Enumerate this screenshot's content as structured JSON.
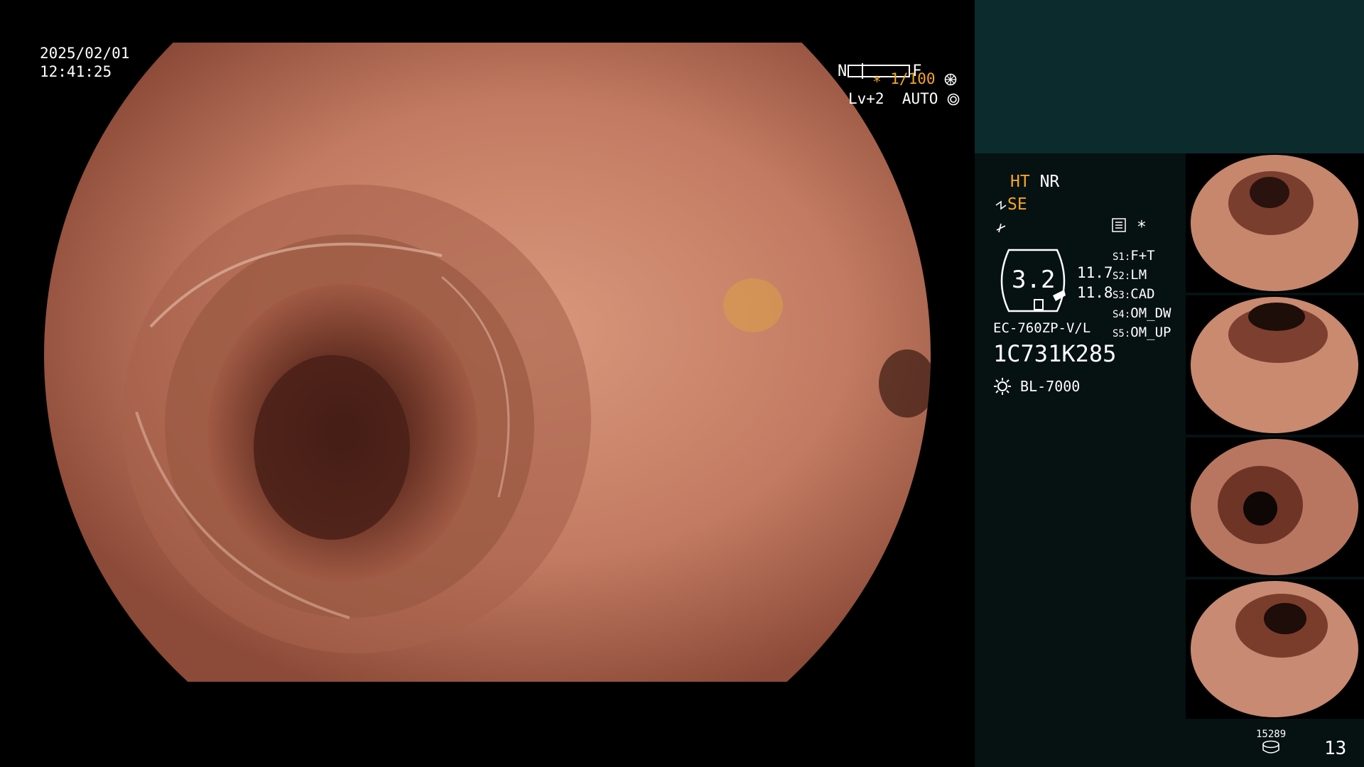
{
  "overlay": {
    "date": "2025/02/01",
    "time": "12:41:25",
    "nf_left": "N",
    "nf_right": "F",
    "shutter": "∗ 1/100",
    "level": "Lv+2  AUTO"
  },
  "panel": {
    "ht": "HT",
    "nr": "NR",
    "se": "SE",
    "zoom_value": "3.2",
    "val1": "11.7",
    "val2": "11.8",
    "s1_key": "S1:",
    "s1_val": "F+T",
    "s2_key": "S2:",
    "s2_val": "LM",
    "s3_key": "S3:",
    "s3_val": "CAD",
    "s4_key": "S4:",
    "s4_val": "OM_DW",
    "s5_key": "S5:",
    "s5_val": "OM_UP",
    "scope_model": "EC-760ZP-V/L",
    "serial": "1C731K285",
    "light_source": "BL-7000",
    "count_small": "15289",
    "count_large": "13"
  },
  "colors": {
    "accent": "#f5a623",
    "panel_top": "#0c2b2d",
    "panel_bg": "#061112",
    "mucosa": "#c8806a"
  }
}
